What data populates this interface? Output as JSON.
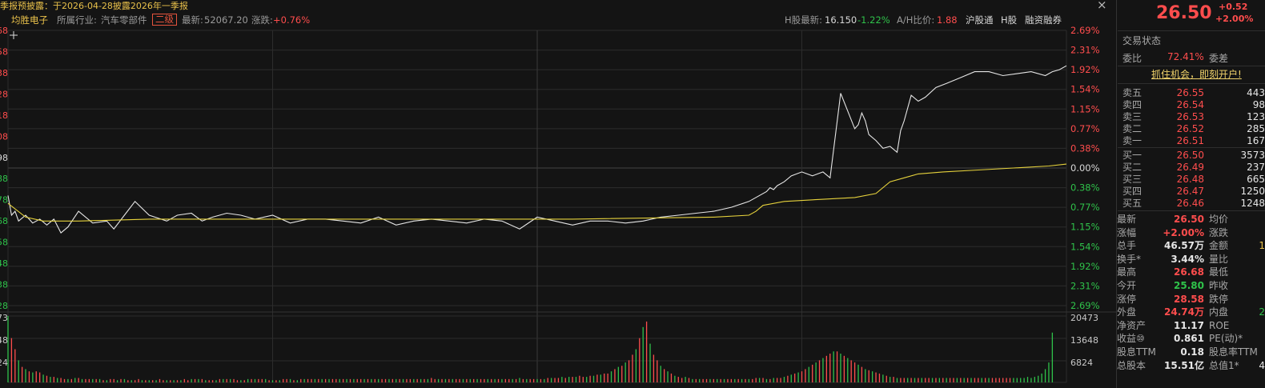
{
  "notice": "季报预披露：于2026-04-28披露2026年一季报",
  "close_glyph": "×",
  "infobar": {
    "stock_name": "均胜电子",
    "industry_label": "所属行业:",
    "industry": "汽车零部件",
    "industry_level": "二级",
    "latest_label": "最新:",
    "latest_value": "52067.20",
    "change_label": "涨跌:",
    "change_value": "+0.76%",
    "h_label": "H股最新:",
    "h_price": "16.150",
    "h_change": "-1.22%",
    "ah_label": "A/H比价:",
    "ah_ratio": "1.88",
    "hgt": "沪股通",
    "hshare": "H股",
    "margin": "融资融券"
  },
  "chart_data": {
    "type": "line",
    "title": "",
    "prev_close": 25.98,
    "y_range": [
      25.28,
      26.68
    ],
    "left_price_ticks_partial": [
      "68",
      "58",
      "38",
      "28",
      "18",
      "08",
      "98",
      "88",
      "78",
      "68",
      "58",
      "48",
      "38",
      "28"
    ],
    "right_pct_ticks": [
      "2.69%",
      "2.31%",
      "1.92%",
      "1.54%",
      "1.15%",
      "0.77%",
      "0.38%",
      "0.00%",
      "0.38%",
      "0.77%",
      "1.15%",
      "1.54%",
      "1.92%",
      "2.31%",
      "2.69%"
    ],
    "volume_ticks": [
      "20473",
      "13648",
      "6824"
    ],
    "volume_left_ticks_partial": [
      "73",
      "48",
      "24"
    ],
    "series": [
      {
        "key": "price",
        "color": "#e6e6e6",
        "x": [
          0,
          1,
          2,
          3,
          5,
          7,
          9,
          11,
          13,
          15,
          17,
          20,
          24,
          28,
          30,
          33,
          36,
          40,
          45,
          48,
          52,
          55,
          58,
          62,
          66,
          70,
          75,
          80,
          85,
          90,
          95,
          100,
          105,
          110,
          115,
          120,
          125,
          130,
          135,
          140,
          145,
          150,
          155,
          160,
          165,
          170,
          175,
          180,
          185,
          190,
          195,
          200,
          205,
          210,
          215,
          216,
          217,
          218,
          220,
          222,
          225,
          228,
          231,
          233,
          236,
          240,
          241,
          242,
          243,
          244,
          246,
          248,
          250,
          252,
          253,
          254,
          256,
          258,
          260,
          263,
          266,
          270,
          274,
          278,
          282,
          286,
          290,
          294,
          296,
          298,
          300
        ],
        "y": [
          25.84,
          25.74,
          25.76,
          25.71,
          25.74,
          25.7,
          25.72,
          25.69,
          25.72,
          25.65,
          25.68,
          25.76,
          25.7,
          25.71,
          25.67,
          25.74,
          25.81,
          25.74,
          25.71,
          25.74,
          25.75,
          25.71,
          25.73,
          25.75,
          25.74,
          25.72,
          25.74,
          25.7,
          25.72,
          25.72,
          25.71,
          25.7,
          25.73,
          25.69,
          25.71,
          25.72,
          25.71,
          25.7,
          25.72,
          25.71,
          25.67,
          25.73,
          25.71,
          25.69,
          25.71,
          25.71,
          25.7,
          25.71,
          25.73,
          25.74,
          25.75,
          25.76,
          25.78,
          25.81,
          25.86,
          25.88,
          25.87,
          25.89,
          25.91,
          25.94,
          25.96,
          25.94,
          25.96,
          25.93,
          26.36,
          26.18,
          26.2,
          26.26,
          26.22,
          26.15,
          26.12,
          26.08,
          26.09,
          26.06,
          26.17,
          26.22,
          26.35,
          26.32,
          26.34,
          26.39,
          26.41,
          26.44,
          26.47,
          26.47,
          26.45,
          26.46,
          26.47,
          26.45,
          26.47,
          26.48,
          26.5
        ]
      },
      {
        "key": "avg",
        "color": "#e6d23c",
        "x": [
          0,
          5,
          10,
          20,
          40,
          80,
          120,
          160,
          200,
          210,
          212,
          214,
          220,
          230,
          240,
          246,
          250,
          254,
          258,
          265,
          275,
          285,
          295,
          300
        ],
        "y": [
          25.8,
          25.73,
          25.71,
          25.71,
          25.72,
          25.72,
          25.72,
          25.72,
          25.73,
          25.74,
          25.76,
          25.79,
          25.81,
          25.82,
          25.83,
          25.85,
          25.91,
          25.93,
          25.95,
          25.96,
          25.97,
          25.98,
          25.99,
          26.0
        ]
      }
    ],
    "volume": [
      60,
      40,
      30,
      20,
      14,
      12,
      10,
      9,
      10,
      9,
      7,
      6,
      5,
      5,
      4,
      4,
      3,
      3,
      3,
      4,
      4,
      3,
      3,
      3,
      3,
      3,
      3,
      2,
      2,
      3,
      3,
      2,
      3,
      3,
      2,
      2,
      2,
      3,
      2,
      2,
      2,
      2,
      2,
      3,
      2,
      2,
      2,
      2,
      2,
      2,
      3,
      2,
      3,
      3,
      3,
      3,
      2,
      2,
      2,
      2,
      3,
      3,
      3,
      3,
      3,
      2,
      2,
      2,
      3,
      3,
      3,
      3,
      3,
      3,
      2,
      2,
      2,
      2,
      3,
      3,
      3,
      2,
      2,
      3,
      3,
      3,
      3,
      3,
      3,
      3,
      3,
      3,
      3,
      3,
      3,
      3,
      3,
      3,
      3,
      3,
      3,
      3,
      3,
      3,
      3,
      3,
      3,
      3,
      3,
      3,
      3,
      3,
      3,
      3,
      3,
      3,
      3,
      3,
      3,
      3,
      4,
      3,
      3,
      3,
      3,
      3,
      3,
      3,
      3,
      3,
      3,
      3,
      3,
      3,
      3,
      3,
      3,
      3,
      3,
      3,
      3,
      3,
      3,
      3,
      3,
      4,
      3,
      3,
      3,
      3,
      3,
      3,
      3,
      4,
      4,
      4,
      4,
      5,
      4,
      5,
      5,
      5,
      6,
      5,
      5,
      6,
      6,
      7,
      7,
      8,
      8,
      10,
      12,
      14,
      15,
      18,
      20,
      25,
      30,
      40,
      50,
      55,
      35,
      25,
      20,
      15,
      12,
      10,
      8,
      6,
      5,
      4,
      5,
      4,
      3,
      3,
      3,
      3,
      3,
      3,
      3,
      3,
      3,
      3,
      3,
      3,
      3,
      3,
      3,
      3,
      3,
      3,
      4,
      4,
      4,
      3,
      3,
      4,
      4,
      4,
      5,
      6,
      7,
      8,
      9,
      10,
      12,
      14,
      16,
      18,
      20,
      22,
      24,
      26,
      28,
      28,
      26,
      24,
      22,
      20,
      18,
      16,
      14,
      12,
      11,
      10,
      9,
      8,
      7,
      6,
      5,
      5,
      4,
      4,
      4,
      4,
      4,
      4,
      4,
      4,
      4,
      4,
      4,
      4,
      4,
      4,
      4,
      4,
      4,
      4,
      4,
      4,
      4,
      4,
      4,
      4,
      4,
      4,
      4,
      4,
      4,
      4,
      4,
      4,
      4,
      4,
      4,
      4,
      4,
      5,
      4,
      5,
      6,
      8,
      12,
      18,
      45
    ],
    "volume_up": [
      0,
      1,
      1,
      0,
      1,
      0,
      1,
      0,
      1,
      1,
      0,
      1,
      0,
      1,
      0,
      1,
      1,
      0,
      1,
      0,
      1,
      0,
      1,
      1,
      0,
      1,
      0,
      1,
      0,
      1,
      1,
      0,
      1,
      0,
      1,
      0,
      1,
      1,
      0,
      1,
      0,
      1,
      0,
      1,
      1,
      0,
      1,
      0,
      1,
      0,
      1,
      1,
      0,
      1,
      0,
      1,
      0,
      1,
      1,
      0,
      1,
      0,
      1,
      0,
      1,
      1,
      0,
      1,
      0,
      1,
      0,
      1,
      1,
      0,
      1,
      0,
      1,
      0,
      1,
      1,
      0,
      1,
      0,
      1,
      0,
      1,
      1,
      0,
      1,
      0,
      1,
      0,
      1,
      1,
      0,
      1,
      0,
      1,
      0,
      1,
      1,
      0,
      1,
      0,
      1,
      0,
      1,
      1,
      0,
      1,
      0,
      1,
      0,
      1,
      1,
      0,
      1,
      0,
      1,
      0,
      1,
      1,
      0,
      1,
      0,
      1,
      0,
      1,
      1,
      0,
      1,
      0,
      1,
      0,
      1,
      1,
      0,
      1,
      0,
      1,
      0,
      1,
      1,
      0,
      1,
      0,
      1,
      0,
      1,
      1,
      0,
      1,
      0,
      1,
      0,
      1,
      1,
      0,
      1,
      0,
      1,
      0,
      1,
      1,
      0,
      1,
      0,
      1,
      0,
      1,
      1,
      0,
      1,
      0,
      1,
      0,
      1,
      1,
      0,
      1,
      0,
      1,
      0,
      1,
      1,
      0,
      1,
      0,
      1,
      0,
      1,
      1,
      0,
      1,
      0,
      1,
      0,
      1,
      1,
      0,
      1,
      0,
      1,
      0,
      1,
      1,
      0,
      1,
      0,
      1,
      0,
      1,
      1,
      0,
      1,
      0,
      1,
      0,
      1,
      1,
      0,
      1,
      0,
      1,
      0,
      1,
      1,
      0,
      1,
      0,
      1,
      0,
      1,
      1,
      0,
      1,
      0,
      1,
      0,
      1,
      1,
      0,
      1,
      0,
      1,
      0,
      1,
      1,
      0,
      1,
      0,
      1,
      0,
      1,
      1,
      0,
      1,
      0,
      1,
      0,
      1,
      1,
      0,
      1,
      0,
      1,
      0,
      1,
      1,
      0,
      1,
      0,
      1,
      0,
      1,
      1,
      0,
      1,
      0,
      1,
      1,
      1,
      1,
      1,
      1
    ]
  },
  "quote": {
    "price": "26.50",
    "change": "+0.52",
    "change_pct": "+2.00%",
    "status_label": "交易状态",
    "weibi_label": "委比",
    "weibi": "72.41%",
    "weicha_label": "委差",
    "promo": "抓住机会，即刻开户!",
    "asks": [
      {
        "label": "卖五",
        "price": "26.55",
        "vol": "443"
      },
      {
        "label": "卖四",
        "price": "26.54",
        "vol": "98"
      },
      {
        "label": "卖三",
        "price": "26.53",
        "vol": "123"
      },
      {
        "label": "卖二",
        "price": "26.52",
        "vol": "285"
      },
      {
        "label": "卖一",
        "price": "26.51",
        "vol": "167"
      }
    ],
    "bids": [
      {
        "label": "买一",
        "price": "26.50",
        "vol": "3573"
      },
      {
        "label": "买二",
        "price": "26.49",
        "vol": "237"
      },
      {
        "label": "买三",
        "price": "26.48",
        "vol": "665"
      },
      {
        "label": "买四",
        "price": "26.47",
        "vol": "1250"
      },
      {
        "label": "买五",
        "price": "26.46",
        "vol": "1248"
      }
    ],
    "stats": [
      {
        "l1": "最新",
        "v1": "26.50",
        "c1": "r",
        "l2": "均价"
      },
      {
        "l1": "涨幅",
        "v1": "+2.00%",
        "c1": "r",
        "l2": "涨跌"
      },
      {
        "l1": "总手",
        "v1": "46.57万",
        "c1": "w",
        "l2": "金额",
        "v2": "1",
        "c2": "y"
      },
      {
        "l1": "换手*",
        "v1": "3.44%",
        "c1": "w",
        "l2": "量比"
      },
      {
        "l1": "最高",
        "v1": "26.68",
        "c1": "r",
        "l2": "最低"
      },
      {
        "l1": "今开",
        "v1": "25.80",
        "c1": "g",
        "l2": "昨收"
      },
      {
        "l1": "涨停",
        "v1": "28.58",
        "c1": "r",
        "l2": "跌停"
      },
      {
        "l1": "外盘",
        "v1": "24.74万",
        "c1": "r",
        "l2": "内盘",
        "v2": "2",
        "c2": "g"
      },
      {
        "l1": "净资产",
        "v1": "11.17",
        "c1": "w",
        "l2": "ROE"
      },
      {
        "l1": "收益⑩",
        "v1": "0.861",
        "c1": "w",
        "l2": "PE(动)*"
      },
      {
        "l1": "股息TTM",
        "v1": "0.18",
        "c1": "w",
        "l2": "股息率TTM"
      },
      {
        "l1": "总股本",
        "v1": "15.51亿",
        "c1": "w",
        "l2": "总值1*",
        "v2": "4",
        "c2": "w"
      }
    ]
  },
  "colors": {
    "up": "#ff4d4d",
    "down": "#2fc24a",
    "price_line": "#e6e6e6",
    "avg_line": "#e6d23c",
    "grid": "#2c2c2c"
  }
}
